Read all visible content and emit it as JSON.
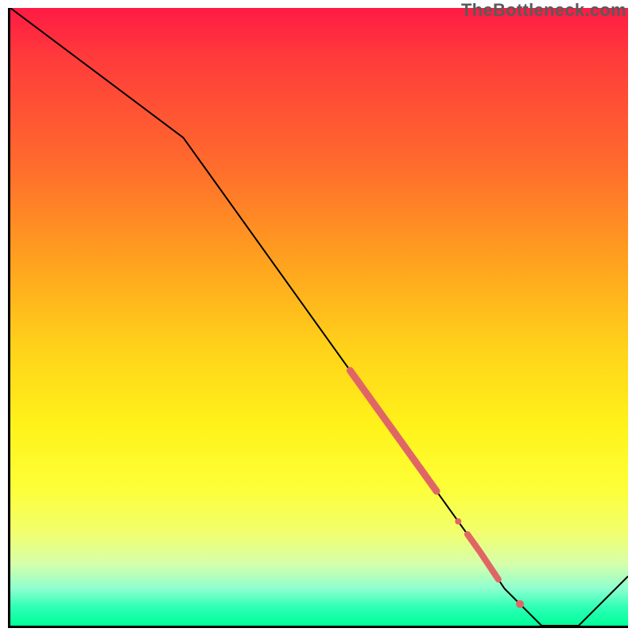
{
  "watermark": "TheBottleneck.com",
  "chart_data": {
    "type": "line",
    "title": "",
    "xlabel": "",
    "ylabel": "",
    "xlim": [
      0,
      100
    ],
    "ylim": [
      0,
      100
    ],
    "grid": false,
    "series": [
      {
        "name": "bottleneck-curve",
        "x": [
          0,
          28,
          76,
          80,
          82,
          86,
          92,
          100
        ],
        "y": [
          100,
          79,
          12,
          6,
          4,
          0,
          0,
          8
        ]
      }
    ],
    "markers": [
      {
        "name": "thick-segment-1",
        "x_start": 55,
        "x_end": 69,
        "width": 9
      },
      {
        "name": "dot-1",
        "x": 72.5,
        "radius": 4
      },
      {
        "name": "thick-segment-2",
        "x_start": 74,
        "x_end": 79,
        "width": 8
      },
      {
        "name": "dot-2",
        "x": 82.5,
        "radius": 5
      }
    ],
    "marker_color": "#e06666",
    "line_color": "#000000",
    "background_gradient": [
      "#ff1a44",
      "#ff6a2d",
      "#ffd21a",
      "#fdff3a",
      "#00ff99"
    ]
  }
}
